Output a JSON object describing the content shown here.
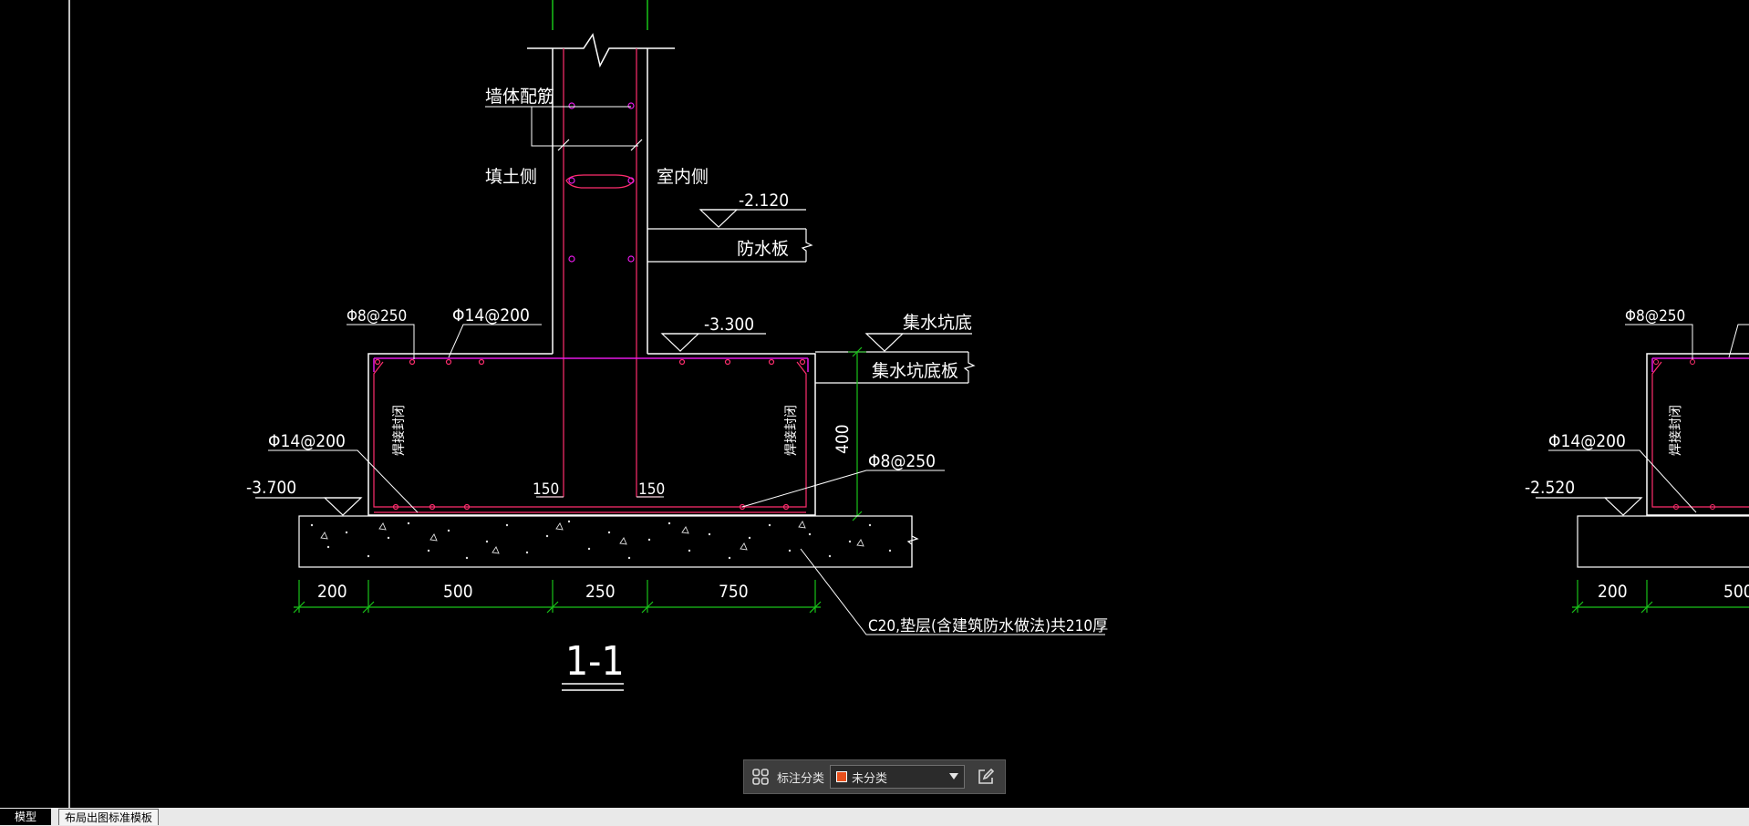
{
  "drawing": {
    "section_label": "1-1",
    "labels": {
      "wall_rebar": "墙体配筋",
      "fill_side": "填土侧",
      "indoor_side": "室内侧",
      "waterproof_slab": "防水板",
      "sump_bottom": "集水坑底",
      "sump_bottom_slab": "集水坑底板",
      "weld_closure": "焊接封闭",
      "cushion_note": "C20,垫层(含建筑防水做法)共210厚"
    },
    "elevations": [
      "-2.120",
      "-3.300",
      "-3.700",
      "-2.520"
    ],
    "rebar": [
      "Φ8@250",
      "Φ14@200"
    ],
    "dims_bottom": [
      "200",
      "500",
      "250",
      "750"
    ],
    "dim_vertical": "400",
    "dim_150": "150"
  },
  "toolbar": {
    "label": "标注分类",
    "selected": "未分类",
    "swatch_color": "#e8501d",
    "grid_icon": "grid-icon",
    "edit_icon": "edit-icon"
  },
  "tabs": {
    "model": "模型",
    "layout": "布局出图标准模板"
  },
  "colors": {
    "wall": "#ff2d6e",
    "rebar_mag": "#e619e6",
    "dim_green": "#19c319",
    "line_white": "#ffffff"
  }
}
